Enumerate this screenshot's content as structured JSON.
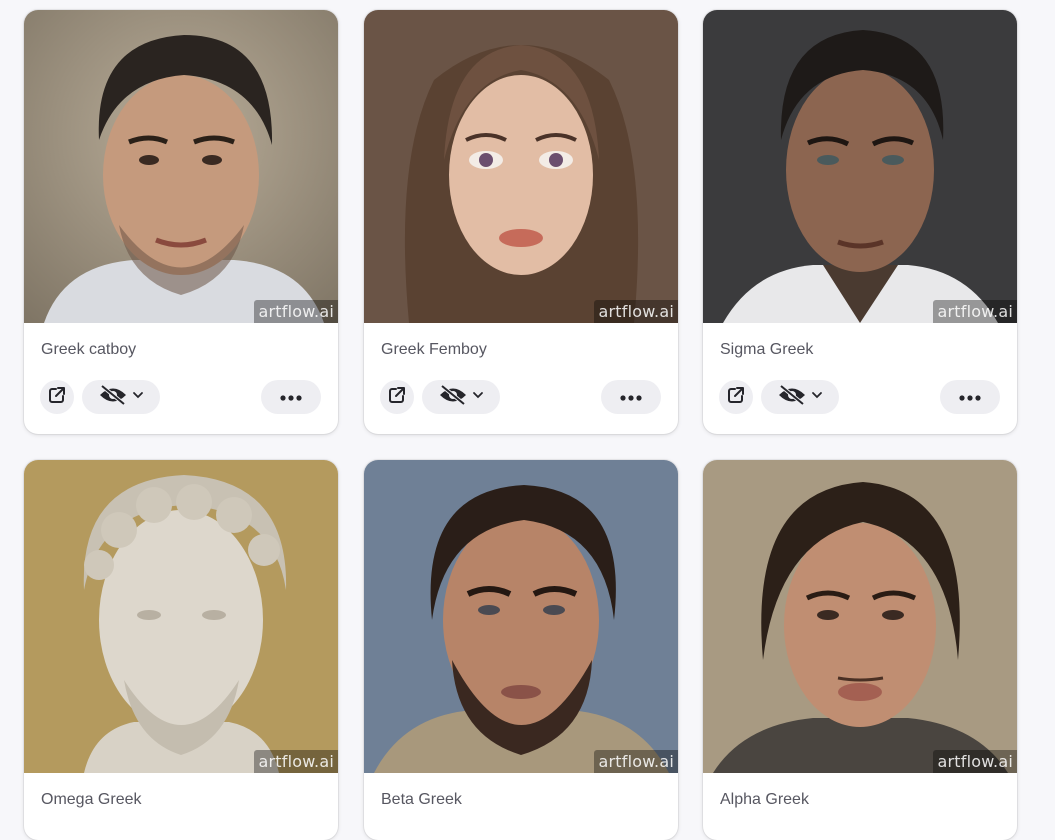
{
  "watermark_text": "artflow.ai",
  "icons": {
    "share": "external-link-icon",
    "visibility": "eye-off-icon",
    "dropdown": "chevron-down-icon",
    "more": "more-horizontal-icon"
  },
  "cards": [
    {
      "title": "Greek catboy"
    },
    {
      "title": "Greek Femboy"
    },
    {
      "title": "Sigma Greek"
    },
    {
      "title": "Omega Greek"
    },
    {
      "title": "Beta Greek"
    },
    {
      "title": "Alpha Greek"
    }
  ]
}
